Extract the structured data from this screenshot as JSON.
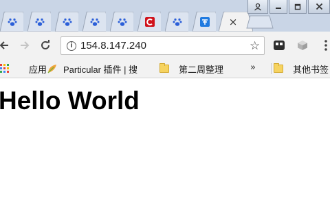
{
  "tabs": [
    {
      "icon": "baidu-paw-icon",
      "active": false
    },
    {
      "icon": "baidu-paw-icon",
      "active": false
    },
    {
      "icon": "baidu-paw-icon",
      "active": false
    },
    {
      "icon": "baidu-paw-icon",
      "active": false
    },
    {
      "icon": "baidu-paw-icon",
      "active": false
    },
    {
      "icon": "red-c-icon",
      "active": false
    },
    {
      "icon": "baidu-paw-icon",
      "active": false
    },
    {
      "icon": "translate-icon",
      "active": false
    },
    {
      "icon": "blank",
      "active": true
    }
  ],
  "tab_close_glyph": "×",
  "toolbar": {
    "url": "154.8.147.240"
  },
  "bookmarks": {
    "apps_label": "应用",
    "item1_label": "Particular 插件 | 搜",
    "item2_label": "第二周整理",
    "more_glyph": "»",
    "other_label": "其他书签"
  },
  "page": {
    "heading": "Hello World"
  },
  "colors": {
    "tabstrip": "#c9d5e6",
    "toolbar": "#f2f2f2",
    "baidu_blue": "#2b5fd8",
    "red_c": "#d0121b",
    "translate_blue": "#1f7ae0"
  }
}
